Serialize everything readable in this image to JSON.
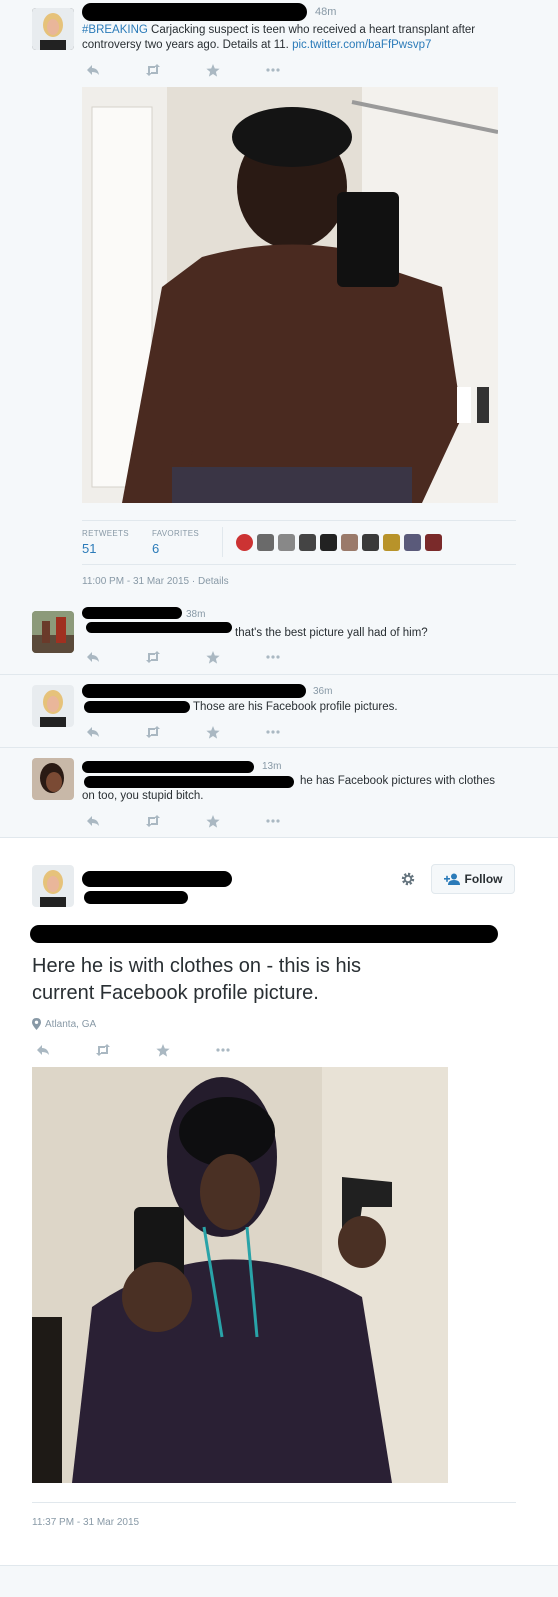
{
  "tweet1": {
    "time": "48m",
    "hashtag": "#BREAKING",
    "text_line1": " Carjacking suspect is teen who received a heart transplant after",
    "text_line2": "controversy two years ago. Details at 11. ",
    "pic_link": "pic.twitter.com/baFfPwsvp7",
    "retweets_label": "RETWEETS",
    "retweets": "51",
    "favorites_label": "FAVORITES",
    "favorites": "6",
    "timestamp": "11:00 PM - 31 Mar 2015",
    "details": "Details"
  },
  "reply1": {
    "time": "38m",
    "text": "that's the best picture yall had of him?"
  },
  "reply2": {
    "time": "36m",
    "text": "Those are his Facebook profile pictures."
  },
  "reply3": {
    "time": "13m",
    "text_line1": "he has Facebook pictures with clothes",
    "text_line2": "on too, you stupid bitch."
  },
  "tweet2": {
    "follow_label": "Follow",
    "text_line1": "Here he is with clothes on - this is his",
    "text_line2": "current Facebook profile picture.",
    "location": "Atlanta, GA",
    "timestamp": "11:37 PM - 31 Mar 2015"
  },
  "colors": {
    "link": "#2b7bb9",
    "muted": "#8899a6",
    "background": "#f5f8fa"
  },
  "icons": [
    "reply-icon",
    "retweet-icon",
    "favorite-icon",
    "more-icon",
    "gear-icon",
    "add-user-icon",
    "location-pin-icon"
  ]
}
